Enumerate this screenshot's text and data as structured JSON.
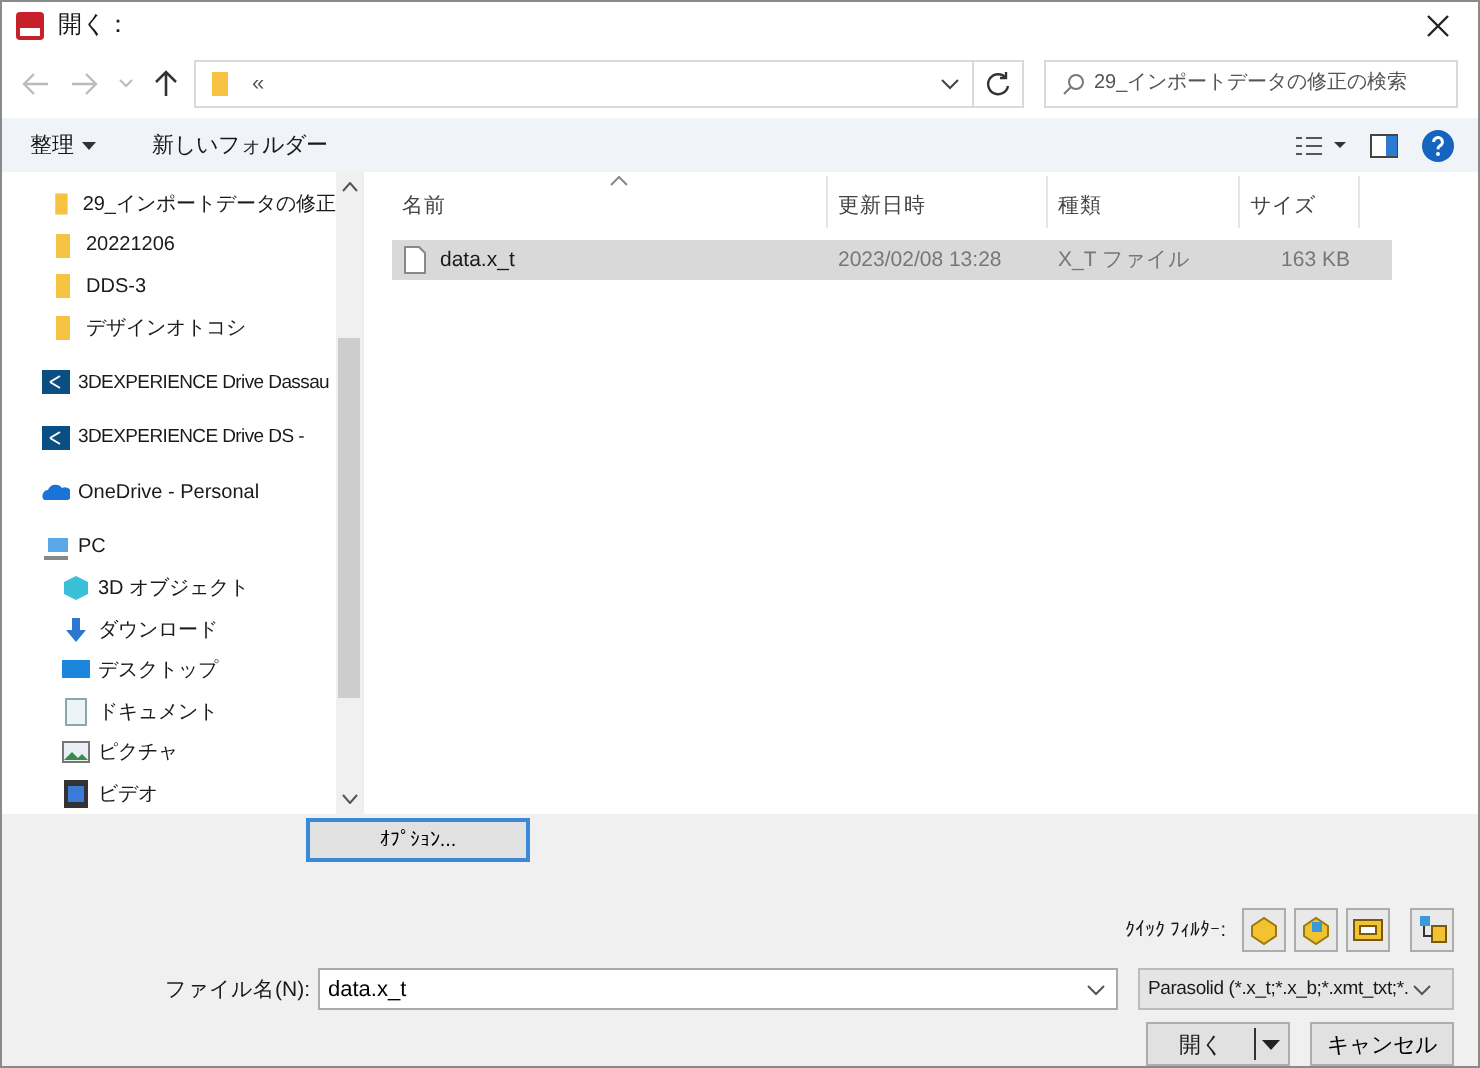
{
  "window": {
    "title": "開く："
  },
  "address": {
    "value": "«"
  },
  "search": {
    "placeholder": "29_インポートデータの修正の検索"
  },
  "toolbar": {
    "organize": "整理",
    "new_folder": "新しいフォルダー"
  },
  "sidebar": {
    "items": [
      {
        "kind": "folder",
        "label": "29_インポートデータの修正"
      },
      {
        "kind": "folder",
        "label": "20221206"
      },
      {
        "kind": "folder",
        "label": "DDS-3"
      },
      {
        "kind": "folder",
        "label": "デザインオトコシ"
      },
      {
        "kind": "drive3d",
        "label": "3DEXPERIENCE Drive Dassau"
      },
      {
        "kind": "drive3d",
        "label": "3DEXPERIENCE Drive DS -"
      },
      {
        "kind": "onedrive",
        "label": "OneDrive - Personal"
      },
      {
        "kind": "pc",
        "label": "PC",
        "children": [
          {
            "kind": "object3d",
            "label": "3D オブジェクト"
          },
          {
            "kind": "download",
            "label": "ダウンロード"
          },
          {
            "kind": "desktop",
            "label": "デスクトップ"
          },
          {
            "kind": "document",
            "label": "ドキュメント"
          },
          {
            "kind": "picture",
            "label": "ピクチャ"
          },
          {
            "kind": "video",
            "label": "ビデオ"
          }
        ]
      }
    ]
  },
  "table": {
    "columns": [
      {
        "label": "名前",
        "sorted": true
      },
      {
        "label": "更新日時",
        "sorted": false
      },
      {
        "label": "種類",
        "sorted": false
      },
      {
        "label": "サイズ",
        "sorted": false
      }
    ],
    "rows": [
      {
        "name": "data.x_t",
        "modified": "2023/02/08 13:28",
        "type": "X_T ファイル",
        "size": "163 KB",
        "selected": true
      }
    ]
  },
  "options_button": "ｵﾌﾟｼｮﾝ...",
  "quick_filter": {
    "label": "ｸｲｯｸ ﾌｨﾙﾀｰ:"
  },
  "filename": {
    "label": "ファイル名(N):",
    "value": "data.x_t"
  },
  "filter": {
    "value": "Parasolid (*.x_t;*.x_b;*.xmt_txt;*."
  },
  "buttons": {
    "open": "開く",
    "cancel": "キャンセル"
  }
}
